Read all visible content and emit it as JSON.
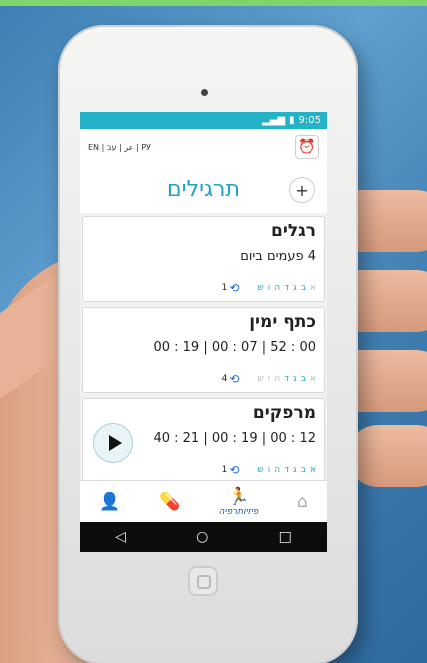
{
  "status": {
    "time": "9:05"
  },
  "languages": "EN | عر | עב | РУ",
  "header": {
    "title": "תרגילים",
    "add_label": "+"
  },
  "exercises": [
    {
      "name": "רגלים",
      "detail": "4 פעמים ביום",
      "repeat": "1",
      "days": [
        "א",
        "ב",
        "ג",
        "ד",
        "ה",
        "ו",
        "ש"
      ],
      "days_active": [
        false,
        true,
        true,
        true,
        true,
        true,
        true
      ],
      "has_play": false
    },
    {
      "name": "כתף ימין",
      "detail": "00 : 52 | 07 : 00 | 19 : 00",
      "repeat": "4",
      "days": [
        "א",
        "ב",
        "ג",
        "ד",
        "ה",
        "ו",
        "ש"
      ],
      "days_active": [
        false,
        true,
        true,
        true,
        false,
        false,
        false
      ],
      "has_play": false
    },
    {
      "name": "מרפקים",
      "detail": "12 : 00 | 19 : 00 | 21 : 40",
      "repeat": "1",
      "days": [
        "א",
        "ב",
        "ג",
        "ד",
        "ה",
        "ו",
        "ש"
      ],
      "days_active": [
        true,
        true,
        true,
        true,
        true,
        true,
        true
      ],
      "has_play": true
    }
  ],
  "nav": {
    "physio_label": "פיזיותרפיה"
  },
  "colors": {
    "accent": "#24b2c9",
    "title": "#24a0c1",
    "nav_active": "#1a5fa6"
  }
}
